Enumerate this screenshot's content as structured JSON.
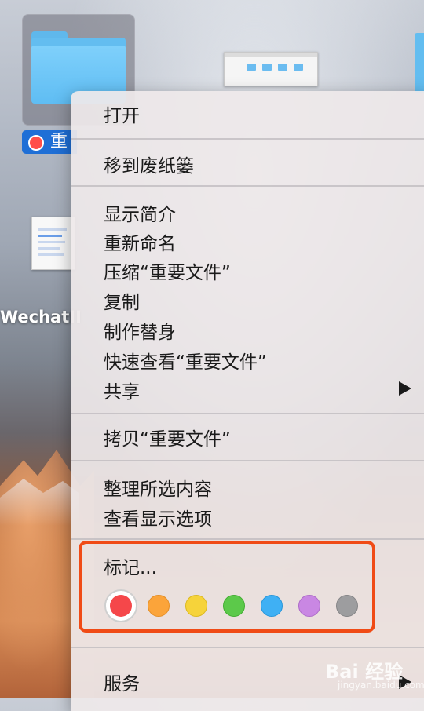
{
  "desktop": {
    "folder_label": "重",
    "file_label": "WechatII"
  },
  "menu": {
    "items": [
      {
        "label": "打开"
      },
      {
        "label": "移到废纸篓"
      },
      {
        "label": "显示简介"
      },
      {
        "label": "重新命名"
      },
      {
        "label": "压缩“重要文件”"
      },
      {
        "label": "复制"
      },
      {
        "label": "制作替身"
      },
      {
        "label": "快速查看“重要文件”"
      },
      {
        "label": "共享"
      },
      {
        "label": "拷贝“重要文件”"
      },
      {
        "label": "整理所选内容"
      },
      {
        "label": "查看显示选项"
      },
      {
        "label": "标记..."
      },
      {
        "label": "服务"
      }
    ],
    "tag_colors": [
      {
        "name": "red",
        "color": "#f5474a"
      },
      {
        "name": "orange",
        "color": "#fba43a"
      },
      {
        "name": "yellow",
        "color": "#f6d33a"
      },
      {
        "name": "green",
        "color": "#5cc94a"
      },
      {
        "name": "blue",
        "color": "#3fb0f4"
      },
      {
        "name": "purple",
        "color": "#c987e3"
      },
      {
        "name": "gray",
        "color": "#9d9d9f"
      }
    ],
    "selected_tag": "red",
    "highlight_color": "#f04b16"
  },
  "watermark": {
    "brand": "Bai 经验",
    "url": "jingyan.baidu.com"
  }
}
